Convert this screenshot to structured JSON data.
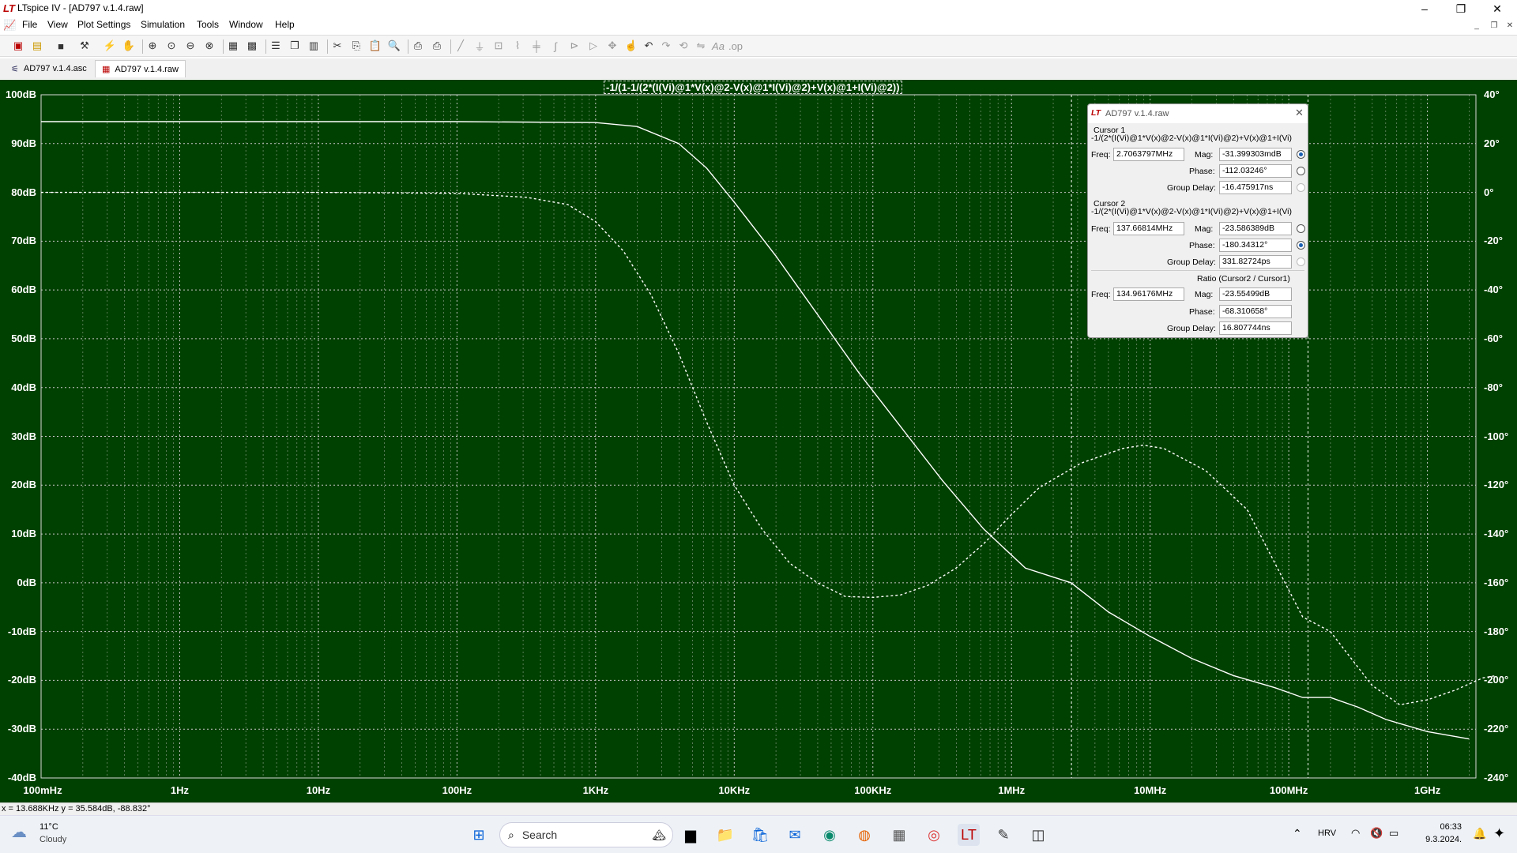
{
  "window": {
    "title": "LTspice IV - [AD797 v.1.4.raw]",
    "minimize": "–",
    "maximize": "❐",
    "close": "✕"
  },
  "menu": [
    "File",
    "View",
    "Plot Settings",
    "Simulation",
    "Tools",
    "Window",
    "Help"
  ],
  "tabs": [
    {
      "label": "AD797 v.1.4.asc",
      "icon": "schematic-icon"
    },
    {
      "label": "AD797 v.1.4.raw",
      "icon": "waveform-icon"
    }
  ],
  "plot": {
    "expression": "-1/(1-1/(2*(I(Vi)@1*V(x)@2-V(x)@1*I(Vi)@2)+V(x)@1+I(Vi)@2))",
    "background": "#004000",
    "trace_color": "#ffffff"
  },
  "chart_data": {
    "type": "line",
    "x_scale": "log",
    "x_range": [
      "100mHz",
      "2GHz"
    ],
    "x_ticks": [
      "100mHz",
      "1Hz",
      "10Hz",
      "100Hz",
      "1KHz",
      "10KHz",
      "100KHz",
      "1MHz",
      "10MHz",
      "100MHz",
      "1GHz"
    ],
    "y_left_ticks": [
      "100dB",
      "90dB",
      "80dB",
      "70dB",
      "60dB",
      "50dB",
      "40dB",
      "30dB",
      "20dB",
      "10dB",
      "0dB",
      "-10dB",
      "-20dB",
      "-30dB",
      "-40dB"
    ],
    "y_left_range": [
      -40,
      100
    ],
    "y_right_ticks": [
      "40°",
      "20°",
      "0°",
      "-20°",
      "-40°",
      "-60°",
      "-80°",
      "-100°",
      "-120°",
      "-140°",
      "-160°",
      "-180°",
      "-200°",
      "-220°",
      "-240°"
    ],
    "y_right_range": [
      -240,
      40
    ],
    "series": [
      {
        "style": "solid",
        "points": [
          [
            -1,
            94.5
          ],
          [
            1,
            94.5
          ],
          [
            2,
            94.5
          ],
          [
            3,
            94.3
          ],
          [
            3.3,
            93.5
          ],
          [
            3.6,
            90
          ],
          [
            3.8,
            85
          ],
          [
            4,
            78
          ],
          [
            4.3,
            67
          ],
          [
            4.6,
            55
          ],
          [
            4.9,
            43
          ],
          [
            5.2,
            32
          ],
          [
            5.5,
            21
          ],
          [
            5.8,
            11
          ],
          [
            6.1,
            3
          ],
          [
            6.43,
            0
          ],
          [
            6.7,
            -6
          ],
          [
            7,
            -11
          ],
          [
            7.3,
            -15.5
          ],
          [
            7.6,
            -19
          ],
          [
            7.9,
            -21.5
          ],
          [
            8.1,
            -23.5
          ],
          [
            8.3,
            -23.5
          ],
          [
            8.5,
            -25.5
          ],
          [
            8.7,
            -28
          ],
          [
            9,
            -30.5
          ],
          [
            9.3,
            -32
          ]
        ]
      },
      {
        "style": "dashed",
        "points": [
          [
            -1,
            80
          ],
          [
            1,
            80
          ],
          [
            2,
            79.8
          ],
          [
            2.5,
            79
          ],
          [
            2.8,
            77.5
          ],
          [
            3,
            74
          ],
          [
            3.2,
            68
          ],
          [
            3.4,
            59
          ],
          [
            3.6,
            47
          ],
          [
            3.8,
            33
          ],
          [
            4,
            20
          ],
          [
            4.2,
            11
          ],
          [
            4.4,
            4
          ],
          [
            4.6,
            0
          ],
          [
            4.8,
            -2.8
          ],
          [
            5,
            -3
          ],
          [
            5.2,
            -2.5
          ],
          [
            5.4,
            -0.5
          ],
          [
            5.6,
            3
          ],
          [
            5.8,
            8
          ],
          [
            6,
            14
          ],
          [
            6.2,
            19.5
          ],
          [
            6.5,
            24.5
          ],
          [
            6.8,
            27.5
          ],
          [
            6.95,
            28.2
          ],
          [
            7.1,
            27.5
          ],
          [
            7.4,
            23
          ],
          [
            7.7,
            15
          ],
          [
            7.9,
            4
          ],
          [
            8.1,
            -7
          ],
          [
            8.3,
            -10
          ],
          [
            8.6,
            -21
          ],
          [
            8.8,
            -25
          ],
          [
            9,
            -24
          ],
          [
            9.2,
            -22
          ],
          [
            9.4,
            -19.5
          ],
          [
            9.5,
            -19
          ]
        ]
      }
    ]
  },
  "cursor_window": {
    "title": "AD797 v.1.4.raw",
    "cursor1": {
      "label": "Cursor 1",
      "expr": "-1/(2*(I(Vi)@1*V(x)@2-V(x)@1*I(Vi)@2)+V(x)@1+I(Vi)",
      "freq_label": "Freq:",
      "freq": "2.7063797MHz",
      "mag_label": "Mag:",
      "mag": "-31.399303mdB",
      "phase_label": "Phase:",
      "phase": "-112.03246°",
      "gd_label": "Group Delay:",
      "gd": "-16.475917ns"
    },
    "cursor2": {
      "label": "Cursor 2",
      "expr": "-1/(2*(I(Vi)@1*V(x)@2-V(x)@1*I(Vi)@2)+V(x)@1+I(Vi)",
      "freq_label": "Freq:",
      "freq": "137.66814MHz",
      "mag_label": "Mag:",
      "mag": "-23.586389dB",
      "phase_label": "Phase:",
      "phase": "-180.34312°",
      "gd_label": "Group Delay:",
      "gd": "331.82724ps"
    },
    "ratio": {
      "label": "Ratio (Cursor2 / Cursor1)",
      "freq_label": "Freq:",
      "freq": "134.96176MHz",
      "mag_label": "Mag:",
      "mag": "-23.55499dB",
      "phase_label": "Phase:",
      "phase": "-68.310658°",
      "gd_label": "Group Delay:",
      "gd": "16.807744ns"
    }
  },
  "status": {
    "text": "x = 13.688KHz   y = 35.584dB, -88.832°"
  },
  "taskbar": {
    "weather_temp": "11°C",
    "weather_desc": "Cloudy",
    "search_placeholder": "Search",
    "lang": "HRV",
    "time": "06:33",
    "date": "9.3.2024."
  }
}
